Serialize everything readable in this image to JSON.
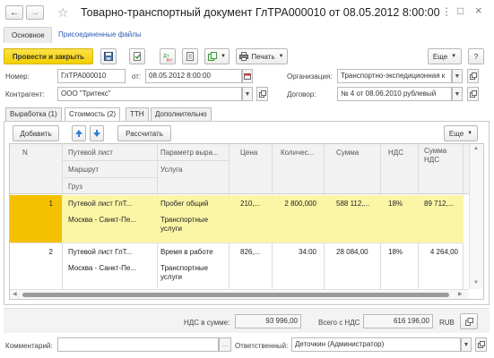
{
  "window": {
    "title": "Товарно-транспортный документ ГлТРА000010 от 08.05.2012 8:00:00",
    "back_icon": "←",
    "forward_icon": "→",
    "star_icon": "☆",
    "menu_icon": "⋮",
    "maximize_icon": "□",
    "close_icon": "×"
  },
  "nav_tabs": {
    "main": "Основное",
    "attached": "Присоединенные файлы"
  },
  "toolbar": {
    "post_close": "Провести и закрыть",
    "print": "Печать",
    "more": "Еще",
    "help": "?"
  },
  "form": {
    "number_label": "Номер:",
    "number_value": "ГлТРА000010",
    "date_from_label": "от:",
    "date_value": "08.05.2012  8:00:00",
    "org_label": "Организация:",
    "org_value": "Транспортно-экспедиционная к",
    "counterparty_label": "Контрагент:",
    "counterparty_value": "ООО \"Тритекс\"",
    "contract_label": "Договор:",
    "contract_value": "№ 4 от 08.06.2010 рублевый"
  },
  "doc_tabs": {
    "output": "Выработка (1)",
    "cost": "Стоимость (2)",
    "ttn": "ТТН",
    "additional": "Дополнительно"
  },
  "table_toolbar": {
    "add": "Добавить",
    "calculate": "Рассчитать",
    "more": "Еще"
  },
  "table": {
    "headers": {
      "n": "N",
      "waybill": "Путевой лист",
      "route": "Маршрут",
      "cargo": "Груз",
      "param": "Параметр выра...",
      "service": "Услуга",
      "price": "Цена",
      "qty": "Количес...",
      "sum": "Сумма",
      "vat": "НДС",
      "vat_sum": "Сумма НДС"
    },
    "rows": [
      {
        "n": "1",
        "waybill": "Путевой лист ГлТ...",
        "route": "Москва - Санкт-Пе...",
        "param": "Пробег общий",
        "service": "Транспортные услуги",
        "price": "210,...",
        "qty": "2 800,000",
        "sum": "588 112,...",
        "vat": "18%",
        "vat_sum": "89 712,..."
      },
      {
        "n": "2",
        "waybill": "Путевой лист ГлТ...",
        "route": "Москва - Санкт-Пе...",
        "param": "Время в работе",
        "service": "Транспортные услуги",
        "price": "826,...",
        "qty": "34:00",
        "sum": "28 084,00",
        "vat": "18%",
        "vat_sum": "4 264,00"
      }
    ]
  },
  "totals": {
    "vat_label": "НДС в сумме:",
    "vat_value": "93 996,00",
    "total_label": "Всего с НДС",
    "total_value": "616 196,00",
    "currency": "RUB"
  },
  "footer": {
    "comment_label": "Комментарий:",
    "comment_value": "",
    "responsible_label": "Ответственный:",
    "responsible_value": "Деточкин (Администратор)"
  },
  "colors": {
    "accent_yellow": "#f5d400",
    "selected_row": "#fbf6a6",
    "selected_cell": "#f5c000"
  }
}
